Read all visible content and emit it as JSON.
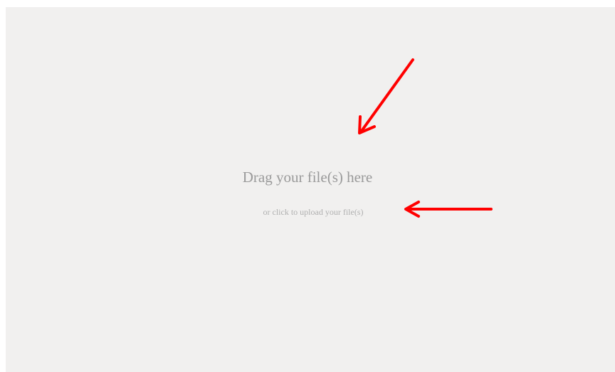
{
  "dropzone": {
    "title": "Drag your file(s) here",
    "subtitle": "or click to upload your file(s)"
  },
  "colors": {
    "dropzone_background": "#f1f0ef",
    "title_text": "#9a9a9a",
    "subtitle_text": "#b0b0b0",
    "annotation_arrow": "#ff0000"
  },
  "annotations": {
    "arrow_1_icon": "arrow-down-left-icon",
    "arrow_2_icon": "arrow-left-icon"
  }
}
